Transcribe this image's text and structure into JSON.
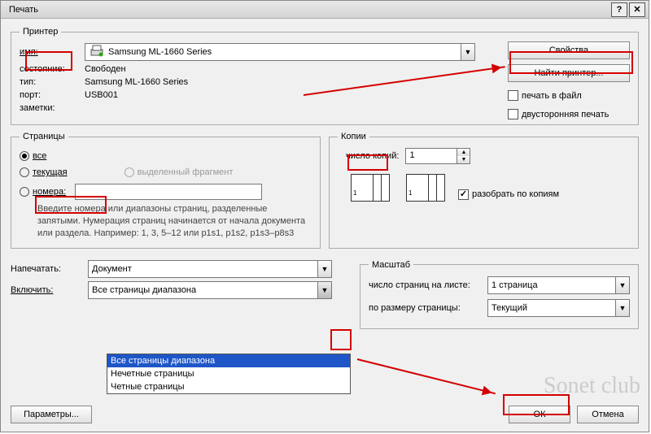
{
  "title": "Печать",
  "printer": {
    "legend": "Принтер",
    "name_label": "имя:",
    "name_value": "Samsung ML-1660 Series",
    "status_label": "состояние:",
    "status_value": "Свободен",
    "type_label": "тип:",
    "type_value": "Samsung ML-1660 Series",
    "port_label": "порт:",
    "port_value": "USB001",
    "notes_label": "заметки:",
    "properties_btn": "Свойства",
    "find_btn": "Найти принтер...",
    "print_to_file": "печать в файл",
    "duplex": "двусторонняя печать"
  },
  "pages": {
    "legend": "Страницы",
    "all": "все",
    "current": "текущая",
    "numbers": "номера:",
    "selection": "выделенный фрагмент",
    "help": "Введите номера или диапазоны страниц, разделенные запятыми. Нумерация страниц начинается от начала документа или раздела. Например: 1, 3, 5–12 или p1s1, p1s2, p1s3–p8s3"
  },
  "copies": {
    "legend": "Копии",
    "count_label": "число копий:",
    "count_value": "1",
    "collate": "разобрать по копиям"
  },
  "print_what": {
    "label": "Напечатать:",
    "value": "Документ"
  },
  "include": {
    "label": "Включить:",
    "value": "Все страницы диапазона",
    "options": [
      "Все страницы диапазона",
      "Нечетные страницы",
      "Четные страницы"
    ]
  },
  "scale": {
    "legend": "Масштаб",
    "pages_per_sheet_label": "число страниц на листе:",
    "pages_per_sheet_value": "1 страница",
    "fit_label": "по размеру страницы:",
    "fit_value": "Текущий"
  },
  "buttons": {
    "params": "Параметры...",
    "ok": "ОК",
    "cancel": "Отмена"
  },
  "watermark": "Sonet club"
}
